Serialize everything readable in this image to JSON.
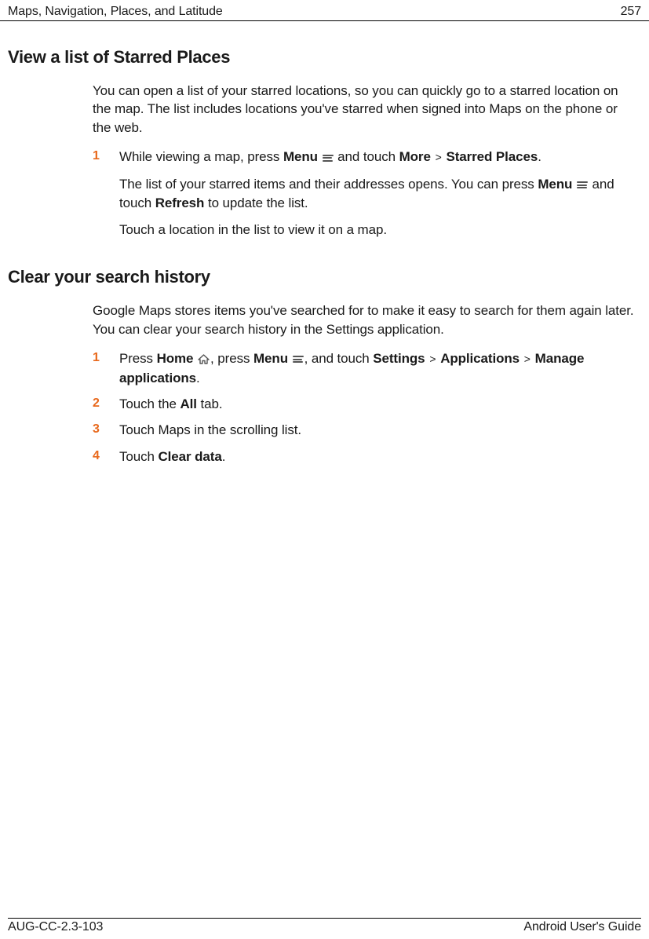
{
  "header": {
    "chapter": "Maps, Navigation, Places, and Latitude",
    "page": "257"
  },
  "footer": {
    "doc_id": "AUG-CC-2.3-103",
    "guide": "Android User's Guide"
  },
  "s1": {
    "title": "View a list of Starred Places",
    "intro": "You can open a list of your starred locations, so you can quickly go to a starred location on the map. The list includes locations you've starred when signed into Maps on the phone or the web.",
    "step1": {
      "num": "1",
      "t1": "While viewing a map, press ",
      "menu1": "Menu",
      "t2": " and touch ",
      "more": "More",
      "t3": " > ",
      "starred": "Starred Places",
      "t4": ".",
      "sub1a": "The list of your starred items and their addresses opens. You can press ",
      "sub1_menu": "Menu",
      "sub1b": " and touch ",
      "sub1_refresh": "Refresh",
      "sub1c": " to update the list.",
      "sub2": "Touch a location in the list to view it on a map."
    }
  },
  "s2": {
    "title": "Clear your search history",
    "intro": "Google Maps stores items you've searched for to make it easy to search for them again later. You can clear your search history in the Settings application.",
    "step1": {
      "num": "1",
      "t1": "Press ",
      "home": "Home",
      "t2": ", press ",
      "menu": "Menu",
      "t3": ", and touch ",
      "settings": "Settings",
      "gt1": " > ",
      "apps": "Applications",
      "gt2": " > ",
      "manage": "Manage applications",
      "t4": "."
    },
    "step2": {
      "num": "2",
      "t1": "Touch the ",
      "all": "All",
      "t2": " tab."
    },
    "step3": {
      "num": "3",
      "t1": "Touch Maps in the scrolling list."
    },
    "step4": {
      "num": "4",
      "t1": "Touch ",
      "clear": "Clear data",
      "t2": "."
    }
  }
}
